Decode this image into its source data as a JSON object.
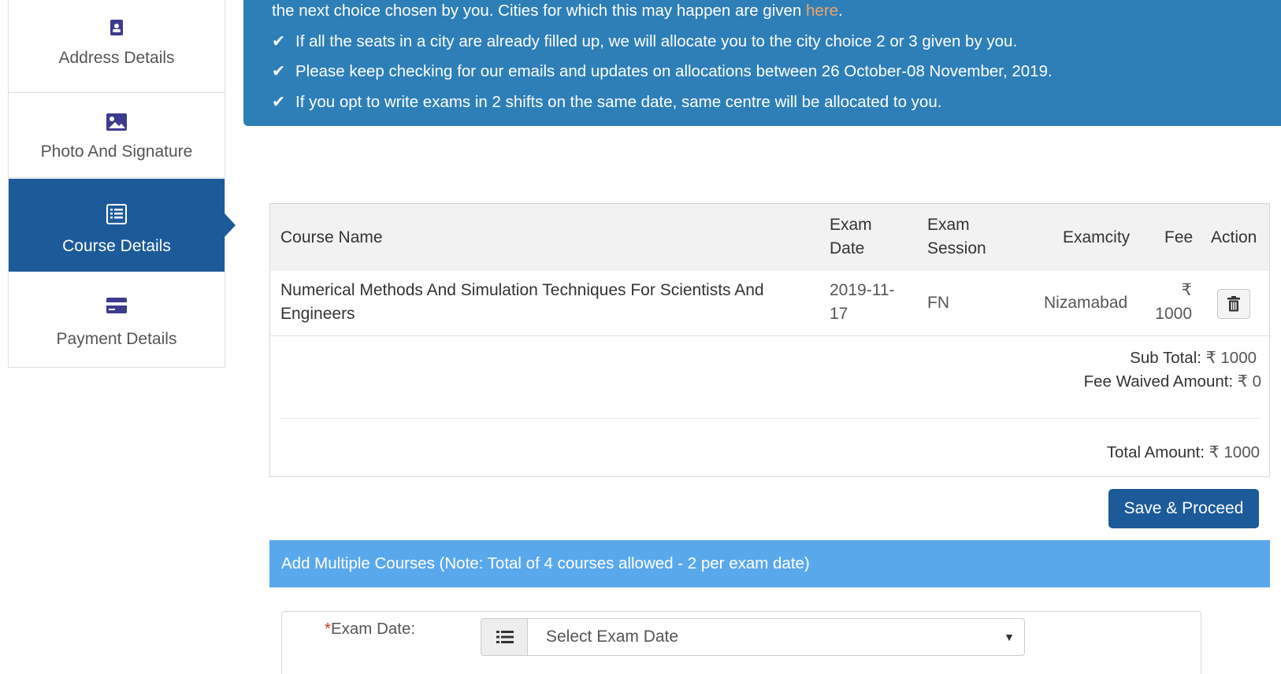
{
  "sidebar": {
    "items": [
      {
        "label": "Address Details",
        "icon": "address-card-icon",
        "active": false
      },
      {
        "label": "Photo And Signature",
        "icon": "image-icon",
        "active": false
      },
      {
        "label": "Course Details",
        "icon": "list-icon",
        "active": true
      },
      {
        "label": "Payment Details",
        "icon": "credit-card-icon",
        "active": false
      }
    ]
  },
  "banner": {
    "line0_text": "the next choice chosen by you. Cities for which this may happen are given ",
    "line0_link": "here",
    "line0_end": ".",
    "bullets": [
      "If all the seats in a city are already filled up, we will allocate you to the city choice 2 or 3 given by you.",
      "Please keep checking for our emails and updates on allocations between 26 October-08 November, 2019.",
      "If you opt to write exams in 2 shifts on the same date, same centre will be allocated to you."
    ],
    "check_glyph": "✔"
  },
  "table": {
    "headers": {
      "course_name": "Course Name",
      "exam_date_1": "Exam",
      "exam_date_2": "Date",
      "exam_session_1": "Exam",
      "exam_session_2": "Session",
      "examcity": "Examcity",
      "fee": "Fee",
      "action": "Action"
    },
    "rows": [
      {
        "course_name_1": "Numerical Methods And Simulation Techniques For Scientists And",
        "course_name_2": "Engineers",
        "exam_date_1": "2019-11-",
        "exam_date_2": "17",
        "session": "FN",
        "city": "Nizamabad",
        "fee_symbol": "₹",
        "fee_value": "1000"
      }
    ],
    "sub_total_label": "Sub Total:",
    "sub_total_value": "₹ 1000",
    "fee_waived_label": "Fee Waived Amount:",
    "fee_waived_value": "₹ 0",
    "total_label": "Total Amount:",
    "total_value": "₹ 1000"
  },
  "save_button": "Save & Proceed",
  "multi_courses_note": "Add Multiple Courses (Note: Total of 4 courses allowed - 2 per exam date)",
  "form": {
    "required_mark": "*",
    "exam_date_label": "Exam Date:",
    "exam_date_select": "Select Exam Date",
    "caret": "▼"
  },
  "colors": {
    "primary": "#1d5a9a",
    "banner": "#2e7fb8",
    "banner_link": "#f0a36a",
    "multi_bar": "#5aa8ec"
  }
}
